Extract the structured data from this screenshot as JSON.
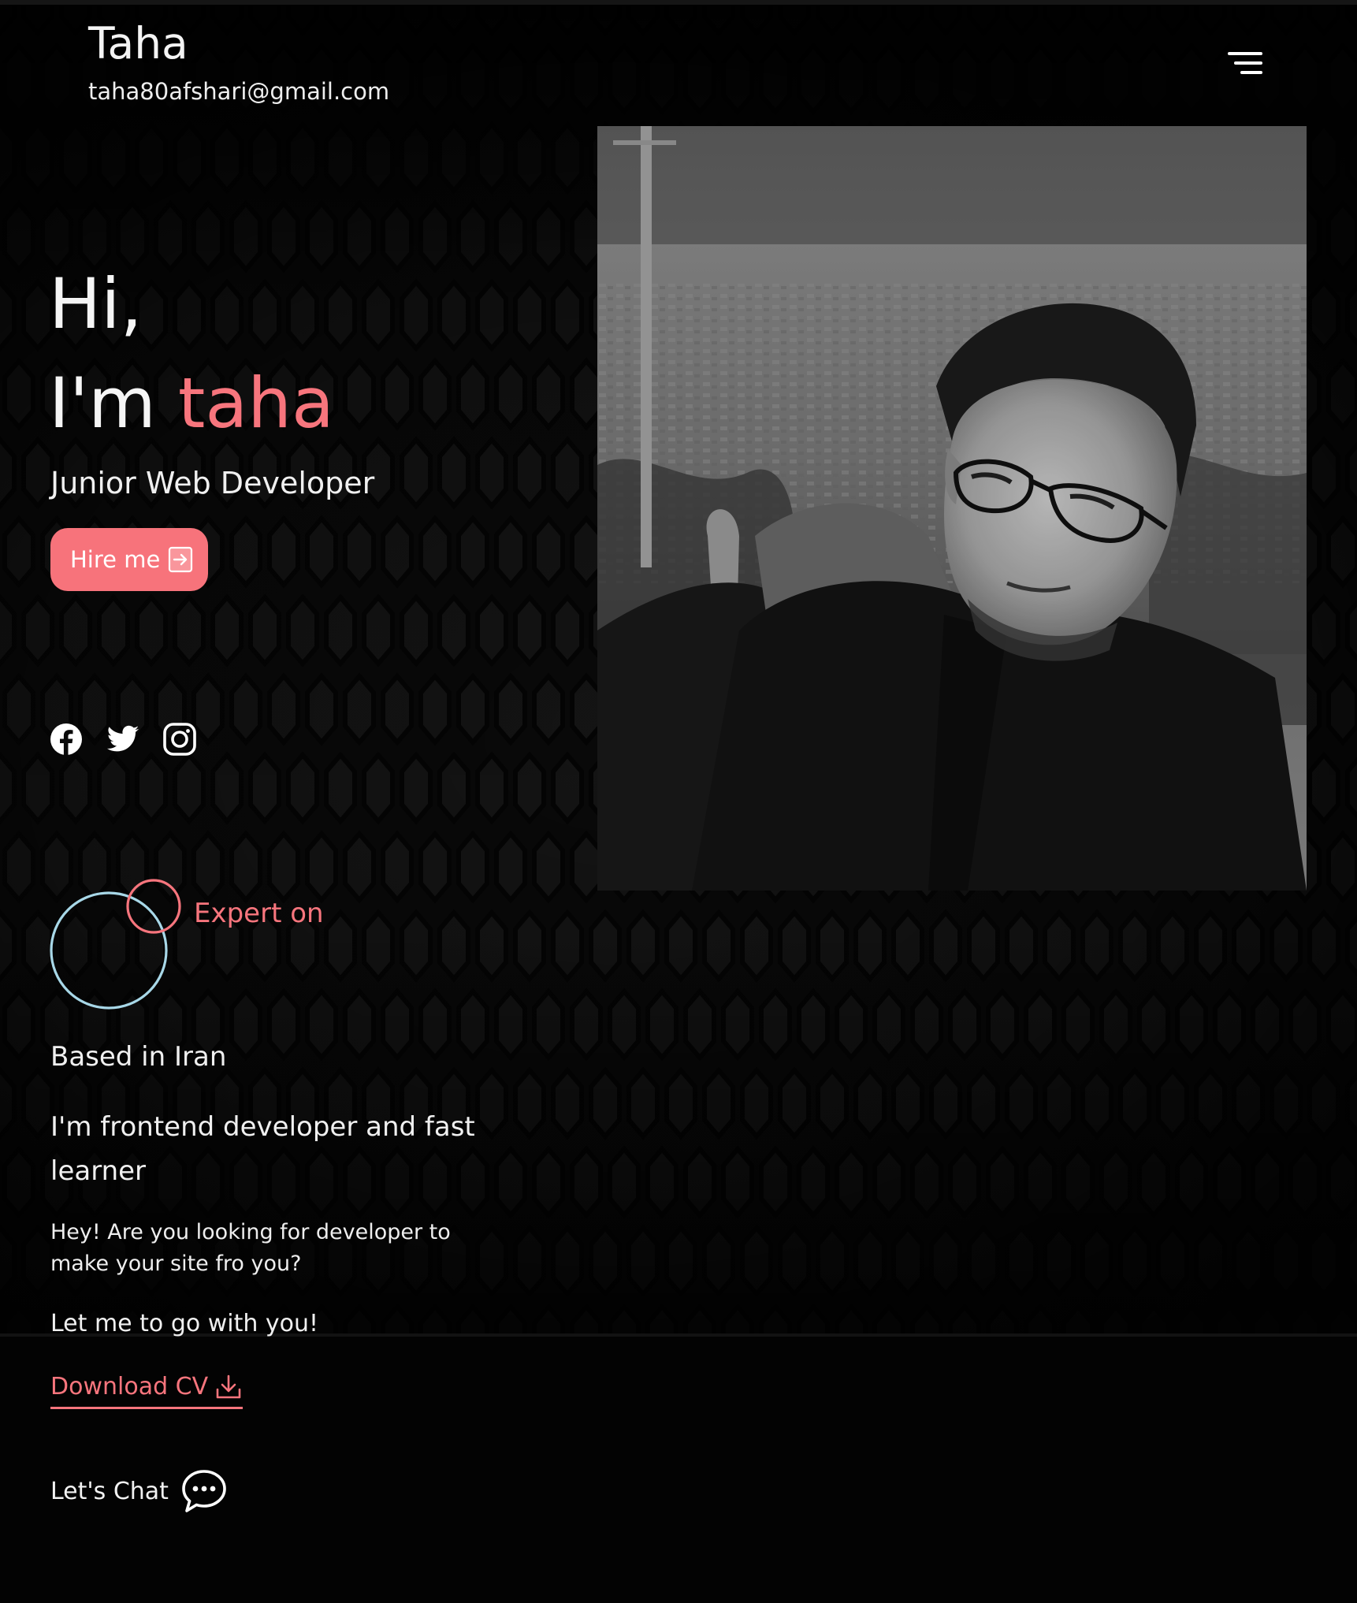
{
  "header": {
    "name": "Taha",
    "email": "taha80afshari@gmail.com",
    "menu_icon": "hamburger-menu-icon"
  },
  "hero": {
    "greeting": "Hi,",
    "intro_prefix": "I'm ",
    "intro_name": "taha",
    "role": "Junior Web Developer",
    "hire_button_label": "Hire me",
    "hire_button_icon": "arrow-right-box-icon",
    "socials": [
      {
        "icon": "facebook-icon"
      },
      {
        "icon": "twitter-icon"
      },
      {
        "icon": "instagram-icon"
      }
    ],
    "photo_icon": "portrait-photo"
  },
  "about": {
    "expert_label": "Expert on",
    "location": "Based in Iran",
    "headline": "I'm frontend developer and fast learner",
    "pitch": "Hey! Are you looking for developer to make your site fro you?",
    "cta": "Let me to go with you!",
    "download_cv_label": "Download CV",
    "download_icon": "download-icon",
    "chat_label": "Let's Chat",
    "chat_icon": "chat-bubble-icon"
  },
  "colors": {
    "accent": "#f7757d",
    "ring_blue": "#a8d8e8",
    "background": "#030303"
  }
}
